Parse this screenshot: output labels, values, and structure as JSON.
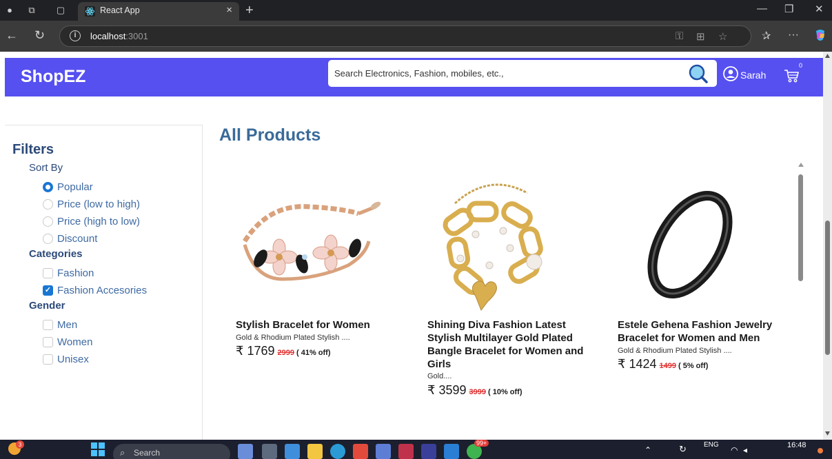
{
  "browser": {
    "tab_title": "React App",
    "url_host": "localhost",
    "url_port": ":3001"
  },
  "app": {
    "brand": "ShopEZ",
    "search_placeholder": "Search Electronics, Fashion, mobiles, etc.,",
    "user_name": "Sarah",
    "cart_count": "0",
    "accent_color": "#5650f1"
  },
  "filters": {
    "title": "Filters",
    "sort_title": "Sort By",
    "sort_options": [
      "Popular",
      "Price (low to high)",
      "Price (high to low)",
      "Discount"
    ],
    "sort_selected": "Popular",
    "categories_title": "Categories",
    "categories": [
      {
        "label": "Fashion",
        "checked": false
      },
      {
        "label": "Fashion Accesories",
        "checked": true
      }
    ],
    "gender_title": "Gender",
    "genders": [
      {
        "label": "Men",
        "checked": false
      },
      {
        "label": "Women",
        "checked": false
      },
      {
        "label": "Unisex",
        "checked": false
      }
    ]
  },
  "products": {
    "title": "All Products",
    "items": [
      {
        "name": "Stylish Bracelet for Women",
        "desc": "Gold & Rhodium Plated Stylish ....",
        "price": "₹ 1769",
        "mrp": "2999",
        "discount": "( 41% off)",
        "image": "rose-gold-flower-bracelet"
      },
      {
        "name": "Shining Diva Fashion Latest Stylish Multilayer Gold Plated Bangle Bracelet for Women and Girls",
        "desc": "Gold....",
        "price": "₹ 3599",
        "mrp": "3999",
        "discount": "( 10% off)",
        "image": "gold-chain-heart-bracelet"
      },
      {
        "name": "Estele Gehena Fashion Jewelry Bracelet for Women and Men",
        "desc": "Gold & Rhodium Plated Stylish ....",
        "price": "₹ 1424",
        "mrp": "1499",
        "discount": "( 5% off)",
        "image": "black-bangle"
      }
    ]
  },
  "taskbar": {
    "search_label": "Search",
    "lang": "ENG",
    "time": "16:48",
    "badge": "99+",
    "notif": "3"
  }
}
